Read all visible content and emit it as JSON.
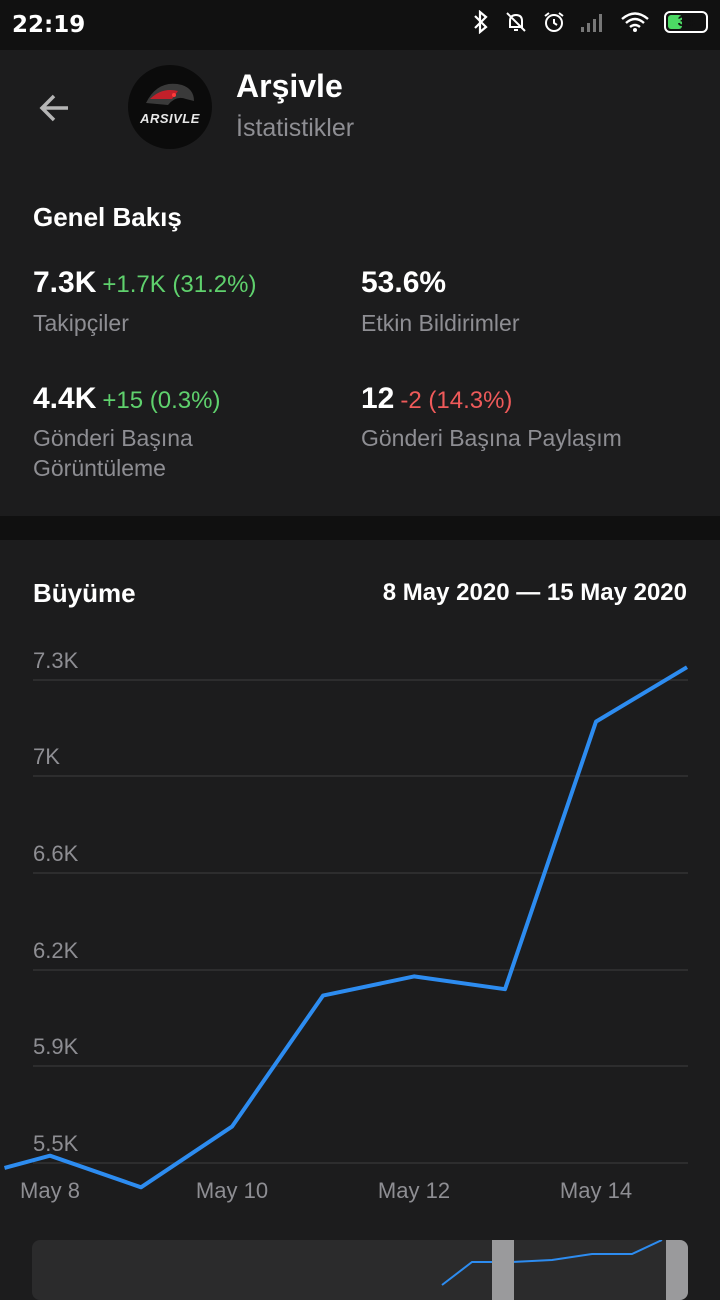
{
  "status_bar": {
    "time": "22:19",
    "battery": "34"
  },
  "header": {
    "title": "Arşivle",
    "subtitle": "İstatistikler",
    "avatar_text": "ARSIVLE"
  },
  "overview": {
    "title": "Genel Bakış",
    "stats": [
      {
        "value": "7.3K",
        "delta": "+1.7K (31.2%)",
        "label": "Takipçiler"
      },
      {
        "value": "53.6%",
        "delta": "",
        "label": "Etkin Bildirimler"
      },
      {
        "value": "4.4K",
        "delta": "+15 (0.3%)",
        "label": "Gönderi Başına Görüntüleme"
      },
      {
        "value": "12",
        "delta": "-2 (14.3%)",
        "label": "Gönderi Başına Paylaşım"
      }
    ]
  },
  "growth": {
    "title": "Büyüme",
    "range": "8 May 2020 — 15 May 2020"
  },
  "colors": {
    "line": "#2d8cf0",
    "positive": "#5fd16d",
    "negative": "#ef5a5a"
  },
  "chart_data": {
    "type": "line",
    "xlabel": "",
    "ylabel": "",
    "y_ticks": [
      "7.3K",
      "7K",
      "6.6K",
      "6.2K",
      "5.9K",
      "5.5K"
    ],
    "x_ticks": [
      "May 8",
      "May 10",
      "May 12",
      "May 14"
    ],
    "series": [
      {
        "x": [
          "2020-05-07 12:00",
          "2020-05-08 00:00",
          "2020-05-09 00:00",
          "2020-05-10 00:00",
          "2020-05-11 00:00",
          "2020-05-12 00:00",
          "2020-05-13 00:00",
          "2020-05-14 00:00",
          "2020-05-15 00:00"
        ],
        "y": [
          5480,
          5530,
          5400,
          5650,
          6120,
          6180,
          6140,
          7170,
          7340
        ]
      }
    ]
  }
}
